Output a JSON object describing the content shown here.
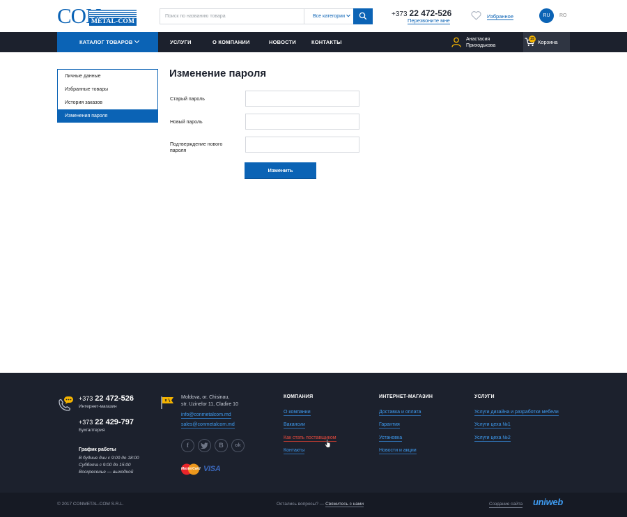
{
  "header": {
    "logo": {
      "main": "CON",
      "sub": "METAL-COM"
    },
    "search": {
      "placeholder": "Поиск по названию товара",
      "category_label": "Все категории"
    },
    "phone": {
      "code": "+373",
      "number": "22 472-526"
    },
    "callback_label": "Перезвоните мне",
    "favorites_label": "Избранное",
    "languages": [
      "RU",
      "RO"
    ],
    "active_language": "RU"
  },
  "nav": {
    "catalog_label": "КАТАЛОГ ТОВАРОВ",
    "items": [
      "УСЛУГИ",
      "О КОМПАНИИ",
      "НОВОСТИ",
      "КОНТАКТЫ"
    ],
    "user": {
      "first_name": "Анастасия",
      "last_name": "Приходькова"
    },
    "cart": {
      "label": "Корзина",
      "count": "15"
    }
  },
  "sidebar": {
    "items": [
      "Личные данные",
      "Избранные товары",
      "История заказов",
      "Изменения пароля"
    ],
    "active_index": 3
  },
  "form": {
    "title": "Изменение пароля",
    "fields": [
      "Старый пароль",
      "Новый пароль",
      "Подтверждение нового пароля"
    ],
    "submit_label": "Изменить"
  },
  "footer": {
    "phones": [
      {
        "code": "+373",
        "number": "22 472-526",
        "label": "Интернет-магазин"
      },
      {
        "code": "+373",
        "number": "22 429-797",
        "label": "Бухгалтерия"
      }
    ],
    "schedule": {
      "title": "График работы",
      "weekdays": "В будние дни с 9:00 до 18:00",
      "saturday": "Суббота с 9:00 до 15:00",
      "sunday": "Воскресенье — выходной"
    },
    "address": {
      "line1": "Moldova, or. Chisinau,",
      "line2": "str. Uzinelor 11, Cladire 10"
    },
    "emails": [
      "info@conmetalcom.md",
      "sales@conmetalcom.md"
    ],
    "social": [
      "f",
      "t",
      "B",
      "ok"
    ],
    "payments": [
      "MasterCard",
      "VISA"
    ],
    "columns": [
      {
        "title": "КОМПАНИЯ",
        "links": [
          "О компании",
          "Вакансии",
          "Как стать поставщиком",
          "Контакты"
        ]
      },
      {
        "title": "ИНТЕРНЕТ-МАГАЗИН",
        "links": [
          "Доставка и оплата",
          "Гарантия",
          "Установка",
          "Новости и акции"
        ]
      },
      {
        "title": "УСЛУГИ",
        "links": [
          "Услуги дизайна и разработки мебели",
          "Услуги цеха №1",
          "Услуги цеха №2"
        ]
      }
    ],
    "copyright": "© 2017  CONMETAL-COM S.R.L.",
    "question": "Остались вопросы?",
    "contact_us": "Свяжитесь с нами",
    "site_credit": "Создание сайта",
    "credit_brand": "uniweb"
  },
  "colors": {
    "brand_blue": "#0b63b5",
    "nav_dark": "#1c212d",
    "footer_link": "#3e9bf0",
    "accent_yellow": "#f5b400"
  }
}
